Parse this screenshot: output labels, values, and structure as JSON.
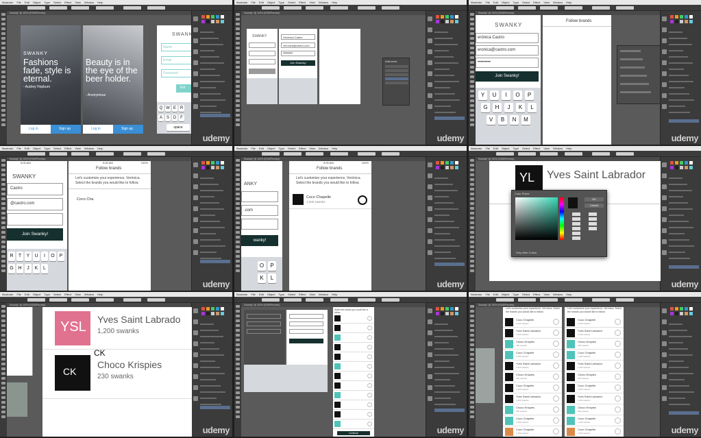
{
  "menu": [
    "Illustrator",
    "File",
    "Edit",
    "Object",
    "Type",
    "Select",
    "Effect",
    "View",
    "Window",
    "Help"
  ],
  "doc_tab": "Swanky* @ 100% (RGB/Preview)",
  "watermark": "udemy",
  "colors": {
    "accent_dark": "#15302e",
    "signup_blue": "#3a8fd6",
    "login_text": "#3a8fd6",
    "pink": "#e0728f",
    "teal": "#4fc3b8",
    "black": "#111111"
  },
  "t1": {
    "brand": "SWANKY",
    "quote1": "Fashions fade, style is eternal.",
    "author1": "- Audrey Hepburn",
    "quote2": "Beauty is in the eye of the beer holder.",
    "author2": "- Anonymous",
    "login": "Log in",
    "signup": "Sign up",
    "brand3": "SWANKY",
    "email_ph": "Email",
    "name_ph": "Name",
    "password_ph": "Password",
    "enter": "Ent",
    "keys_row": [
      "Q",
      "W",
      "E",
      "R"
    ],
    "keys_row2": [
      "A",
      "S",
      "D",
      "F"
    ],
    "space": "space"
  },
  "t2": {
    "brand": "SWANKY",
    "name": "Verónica Castro",
    "email": "veronica@castro.com",
    "password": "••••••••",
    "join": "Join Swanky!",
    "layers_title": "Artboards"
  },
  "t3": {
    "brand": "SWANKY",
    "name": "erónica Castro",
    "email": "eronica@castro.com",
    "password": "•••••••••",
    "join": "Join Swanky!",
    "follow_title": "Follow brands",
    "keys1": [
      "Y",
      "U",
      "I",
      "O",
      "P"
    ],
    "keys2": [
      "G",
      "H",
      "J",
      "K",
      "L"
    ],
    "keys3": [
      "V",
      "B",
      "N",
      "M"
    ]
  },
  "t4": {
    "time": "9:00 AM",
    "battery": "100%",
    "brand": "SWANKY",
    "name": "Castro",
    "email": "@castro.com",
    "join": "Join Swanky!",
    "follow_title": "Follow brands",
    "intro": "Let's customize your experience, Verónica. Select the brands you would like to follow.",
    "typing": "Coco Cha",
    "keys1": [
      "R",
      "T",
      "Y",
      "U",
      "I",
      "O",
      "P"
    ],
    "keys2": [
      "G",
      "H",
      "J",
      "K",
      "L"
    ]
  },
  "t5": {
    "time": "9:00 AM",
    "battery": "100%",
    "brand": "ANKY",
    "email": ".com",
    "join": "wanky!",
    "follow_title": "Follow brands",
    "intro": "Let's customize your experience, Verónica. Select the brands you would like to follow.",
    "brand_name": "Coco Chapelle",
    "brand_count": "1,200 swanks",
    "keys": [
      "O",
      "P"
    ],
    "keys2": [
      "K",
      "L"
    ]
  },
  "t6": {
    "brand_name": "Yves Saint Labrador",
    "logo": "YL",
    "picker_title": "Color Picker",
    "ok": "OK",
    "cancel": "Cancel",
    "web_only": "Only Web Colors"
  },
  "t7": {
    "brand1": "Yves Saint Labrado",
    "count1": "1,200 swanks",
    "logo1": "YSL",
    "brand2": "Choco Krispies",
    "count2": "230 swanks",
    "logo2": "CK",
    "label2": "CK"
  },
  "t8": {
    "header": "Select the brands you would like to follow.",
    "continue": "Continue",
    "rows": 12
  },
  "t9": {
    "intro": "Let's customize your experience, Verónica. Select the brands you would like to follow.",
    "items": [
      {
        "name": "Coco Chapelle",
        "count": "1,200 swanks",
        "logo": "CC",
        "color": "#111111"
      },
      {
        "name": "Yves Saint Labrador",
        "count": "1,200 swanks",
        "logo": "YSL",
        "color": "#111111"
      },
      {
        "name": "Choco Krispies",
        "count": "230 swanks",
        "logo": "CK",
        "color": "#4fc3b8"
      },
      {
        "name": "Coco Chapelle",
        "count": "1,200 swanks",
        "logo": "CC",
        "color": "#4fc3b8"
      },
      {
        "name": "Yves Saint Labrador",
        "count": "1,200 swanks",
        "logo": "YSL",
        "color": "#111111"
      },
      {
        "name": "Choco Krispies",
        "count": "230 swanks",
        "logo": "CK",
        "color": "#111111"
      },
      {
        "name": "Coco Chapelle",
        "count": "1,200 swanks",
        "logo": "CC",
        "color": "#111111"
      },
      {
        "name": "Yves Saint Labrador",
        "count": "1,200 swanks",
        "logo": "YSL",
        "color": "#111111"
      },
      {
        "name": "Choco Krispies",
        "count": "230 swanks",
        "logo": "CK",
        "color": "#4fc3b8"
      },
      {
        "name": "Coco Chapelle",
        "count": "1,200 swanks",
        "logo": "CC",
        "color": "#4fc3b8"
      },
      {
        "name": "Coco Chapelle",
        "count": "1,200 swanks",
        "logo": "CC",
        "color": "#d98a4a"
      }
    ]
  }
}
